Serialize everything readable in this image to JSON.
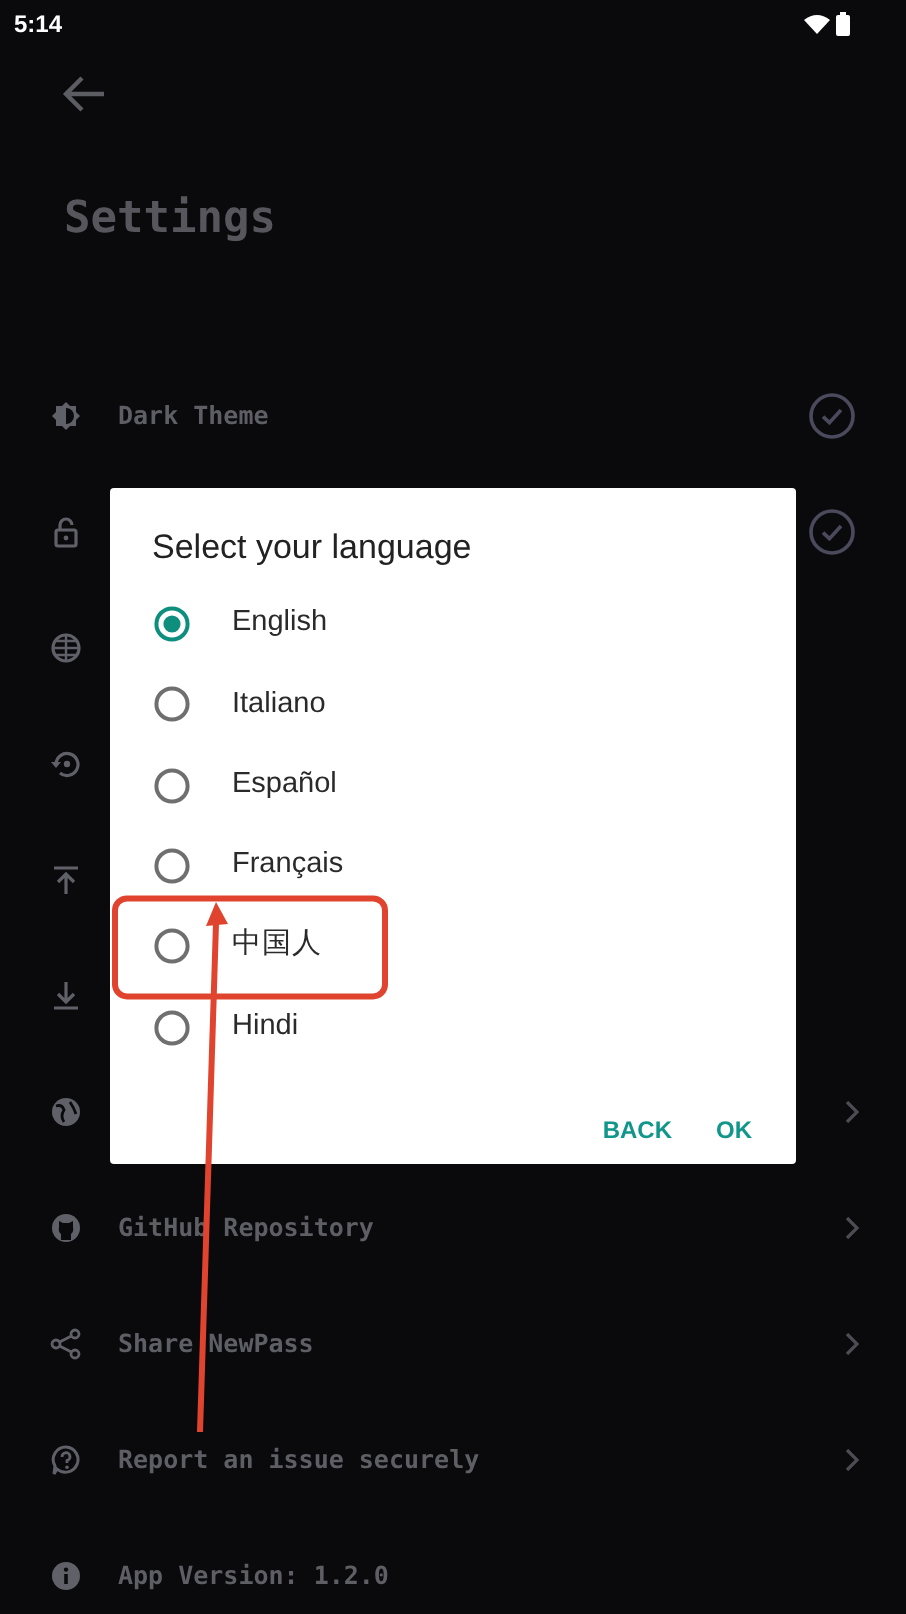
{
  "status_bar": {
    "time": "5:14"
  },
  "title": "Settings",
  "settings": [
    {
      "label": "Dark Theme",
      "kind": "check",
      "checked": true
    },
    {
      "kind": "check",
      "checked": true
    },
    {
      "kind": "plain"
    },
    {
      "kind": "plain"
    },
    {
      "kind": "plain"
    },
    {
      "kind": "plain"
    },
    {
      "kind": "link"
    },
    {
      "label": "GitHub Repository",
      "kind": "link"
    },
    {
      "label": "Share NewPass",
      "kind": "link"
    },
    {
      "label": "Report an issue securely",
      "kind": "link"
    },
    {
      "label": "App Version: 1.2.0",
      "kind": "plain"
    }
  ],
  "dialog": {
    "title": "Select your language",
    "options": [
      {
        "label": "English",
        "selected": true,
        "highlighted": false
      },
      {
        "label": "Italiano",
        "selected": false,
        "highlighted": false
      },
      {
        "label": "Español",
        "selected": false,
        "highlighted": false
      },
      {
        "label": "Français",
        "selected": false,
        "highlighted": false
      },
      {
        "label": "中国人",
        "selected": false,
        "highlighted": true
      },
      {
        "label": "Hindi",
        "selected": false,
        "highlighted": false
      }
    ],
    "buttons": [
      "BACK",
      "OK"
    ]
  }
}
